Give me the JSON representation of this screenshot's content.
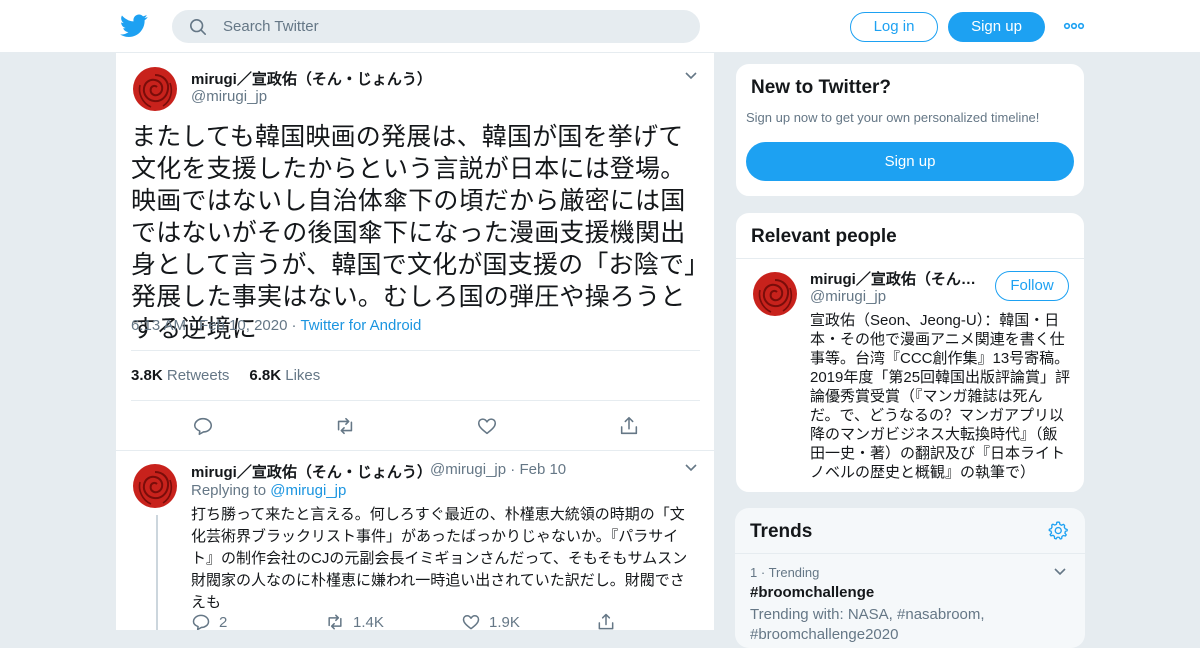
{
  "colors": {
    "accent": "#1da1f2",
    "link": "#1b95e0",
    "text": "#14171a",
    "muted": "#657786",
    "background": "#e6ecf0"
  },
  "header": {
    "logo_icon": "twitter-bird-icon",
    "search_placeholder": "Search Twitter",
    "login_label": "Log in",
    "signup_label": "Sign up",
    "more_icon": "more-dots-icon"
  },
  "tweet": {
    "author_name": "mirugi／宣政佑（そん・じょんう）",
    "author_handle": "@mirugi_jp",
    "text": "またしても韓国映画の発展は、韓国が国を挙げて文化を支援したからという言説が日本には登場。映画ではないし自治体傘下の頃だから厳密には国ではないがその後国傘下になった漫画支援機関出身として言うが、韓国で文化が国支援の「お陰で」発展した事実はない。むしろ国の弾圧や操ろうとする逆境に",
    "time": "6:13 AM",
    "date": "Feb 10, 2020",
    "source": "Twitter for Android",
    "retweets_count": "3.8K",
    "retweets_label": "Retweets",
    "likes_count": "6.8K",
    "likes_label": "Likes"
  },
  "reply": {
    "author_name": "mirugi／宣政佑（そん・じょんう）",
    "author_handle": "@mirugi_jp",
    "date": "Feb 10",
    "replying_label": "Replying to",
    "replying_handle": "@mirugi_jp",
    "text": "打ち勝って来たと言える。何しろすぐ最近の、朴槿恵大統領の時期の「文化芸術界ブラックリスト事件」があったばっかりじゃないか。『パラサイト』の制作会社のCJの元副会長イミギョンさんだって、そもそもサムスン財閥家の人なのに朴槿恵に嫌われ一時追い出されていた訳だし。財閥でさえも",
    "reply_count": "2",
    "retweet_count": "1.4K",
    "like_count": "1.9K"
  },
  "new_to_twitter": {
    "title": "New to Twitter?",
    "subtitle": "Sign up now to get your own personalized timeline!",
    "signup_label": "Sign up"
  },
  "relevant_people": {
    "title": "Relevant people",
    "name": "mirugi／宣政佑（そん・じょんう）",
    "handle": "@mirugi_jp",
    "follow_label": "Follow",
    "bio": "宣政佑（Seon、Jeong-U）：韓国・日本・その他で漫画アニメ関連を書く仕事等。台湾『CCC創作集』13号寄稿。2019年度「第25回韓国出版評論賞」評論優秀賞受賞（『マンガ雑誌は死んだ。で、どうなるの？マンガアプリ以降のマンガビジネス大転換時代』（飯田一史・著）の翻訳及び『日本ライトノベルの歴史と概観』の執筆で）"
  },
  "trends": {
    "title": "Trends",
    "item_rank": "1",
    "item_label": "Trending",
    "item_tag": "#broomchallenge",
    "item_with": "Trending with: NASA, #nasabroom, #broomchallenge2020"
  }
}
